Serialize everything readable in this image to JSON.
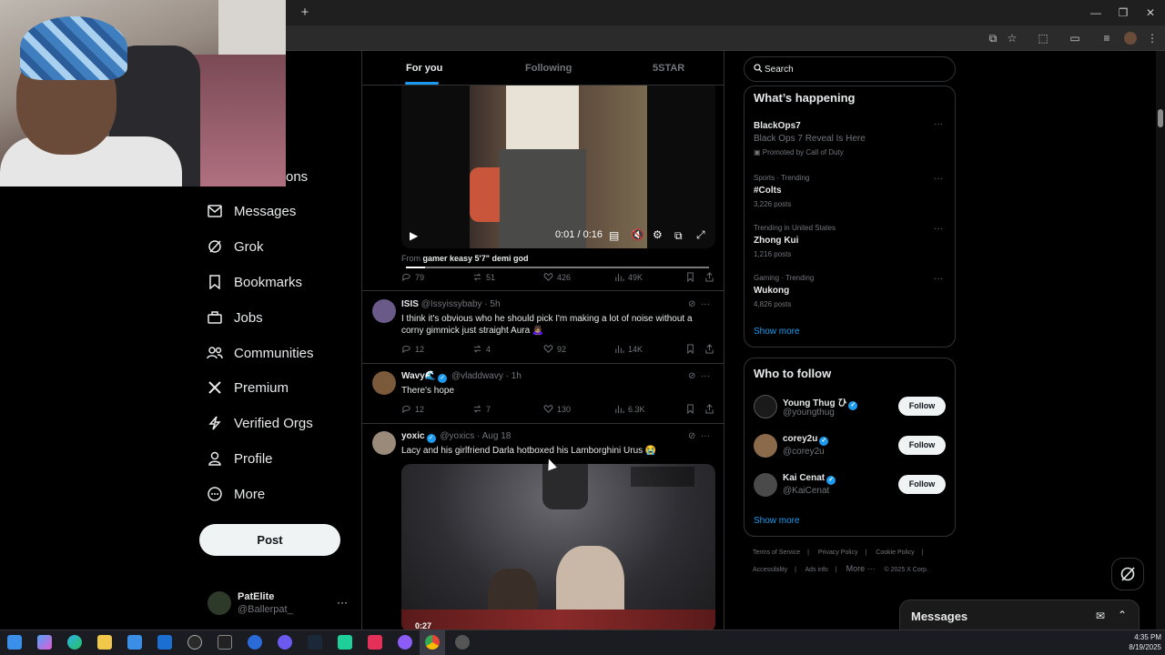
{
  "nav": {
    "partial_label": "ons",
    "items": [
      {
        "label": "Messages",
        "icon": "mail-icon"
      },
      {
        "label": "Grok",
        "icon": "grok-icon"
      },
      {
        "label": "Bookmarks",
        "icon": "bookmark-icon"
      },
      {
        "label": "Jobs",
        "icon": "briefcase-icon"
      },
      {
        "label": "Communities",
        "icon": "people-icon"
      },
      {
        "label": "Premium",
        "icon": "x-logo-icon"
      },
      {
        "label": "Verified Orgs",
        "icon": "lightning-icon"
      },
      {
        "label": "Profile",
        "icon": "person-icon"
      },
      {
        "label": "More",
        "icon": "more-circle-icon"
      }
    ],
    "post_label": "Post",
    "account": {
      "name": "PatElite",
      "handle": "@Ballerpat_",
      "more": "···"
    }
  },
  "feed": {
    "tabs": [
      {
        "label": "For you",
        "active": true
      },
      {
        "label": "Following",
        "active": false
      },
      {
        "label": "5STAR",
        "active": false
      }
    ],
    "video1": {
      "time": "0:01 / 0:16",
      "progress": 0.0625,
      "from_prefix": "From",
      "from_name": "gamer keasy 5'7\" demi god"
    },
    "post0_stats": {
      "replies": "79",
      "reposts": "51",
      "likes": "426",
      "views": "49K"
    },
    "posts": [
      {
        "name": "ISIS",
        "handle": "@Issyissybaby",
        "time": "· 5h",
        "verified": false,
        "text": "I think it's obvious who he should pick I'm making a lot of noise without a corny gimmick just straight Aura 🙇🏽‍♀️",
        "stats": {
          "replies": "12",
          "reposts": "4",
          "likes": "92",
          "views": "14K"
        }
      },
      {
        "name": "Wavy🌊",
        "handle": "@vladdwavy",
        "time": "· 1h",
        "verified": true,
        "text": "There's hope",
        "stats": {
          "replies": "12",
          "reposts": "7",
          "likes": "130",
          "views": "6.3K"
        }
      },
      {
        "name": "yoxic",
        "handle": "@yoxics",
        "time": "· Aug 18",
        "verified": true,
        "text": "Lacy and his girlfriend Darla hotboxed his Lamborghini Urus 😭",
        "video_time": "0:27"
      }
    ]
  },
  "right": {
    "search_placeholder": "Search",
    "happening_title": "What’s happening",
    "trends": [
      {
        "category": "",
        "name": "BlackOps7",
        "sub": "Black Ops 7 Reveal Is Here",
        "count": "Promoted by Call of Duty"
      },
      {
        "category": "Sports · Trending",
        "name": "#Colts",
        "sub": "",
        "count": "3,226 posts"
      },
      {
        "category": "Trending in United States",
        "name": "Zhong Kui",
        "sub": "",
        "count": "1,216 posts"
      },
      {
        "category": "Gaming · Trending",
        "name": "Wukong",
        "sub": "",
        "count": "4,826 posts"
      }
    ],
    "show_more": "Show more",
    "who_title": "Who to follow",
    "follow": [
      {
        "name": "Young Thug ひ",
        "handle": "@youngthug",
        "button": "Follow"
      },
      {
        "name": "corey2u",
        "handle": "@corey2u",
        "button": "Follow"
      },
      {
        "name": "Kai Cenat",
        "handle": "@KaiCenat",
        "button": "Follow"
      }
    ],
    "footer": [
      "Terms of Service",
      "Privacy Policy",
      "Cookie Policy",
      "Accessibility",
      "Ads info",
      "More ···",
      "© 2025 X Corp."
    ],
    "messages_title": "Messages"
  },
  "taskbar": {
    "time": "4:35 PM",
    "date": "8/19/2025"
  },
  "colors": {
    "accent": "#1d9bf0",
    "background": "#000000",
    "border": "#2f3336",
    "muted": "#71767b"
  }
}
